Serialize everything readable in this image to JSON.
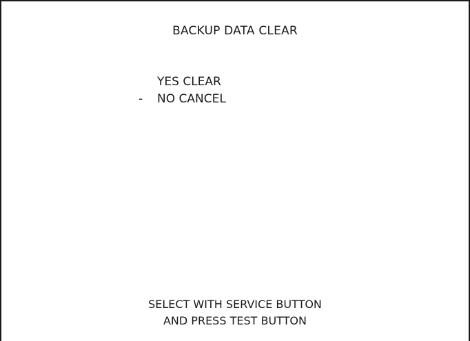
{
  "screen": {
    "title": "BACKUP DATA CLEAR",
    "cursor_symbol": "-",
    "selected_index": 1,
    "options": [
      {
        "label": "YES CLEAR"
      },
      {
        "label": "NO CANCEL"
      }
    ],
    "instructions": [
      "SELECT WITH SERVICE BUTTON",
      "AND PRESS TEST BUTTON"
    ]
  },
  "colors": {
    "background": "#ffffff",
    "text": "#1a1a1a"
  }
}
